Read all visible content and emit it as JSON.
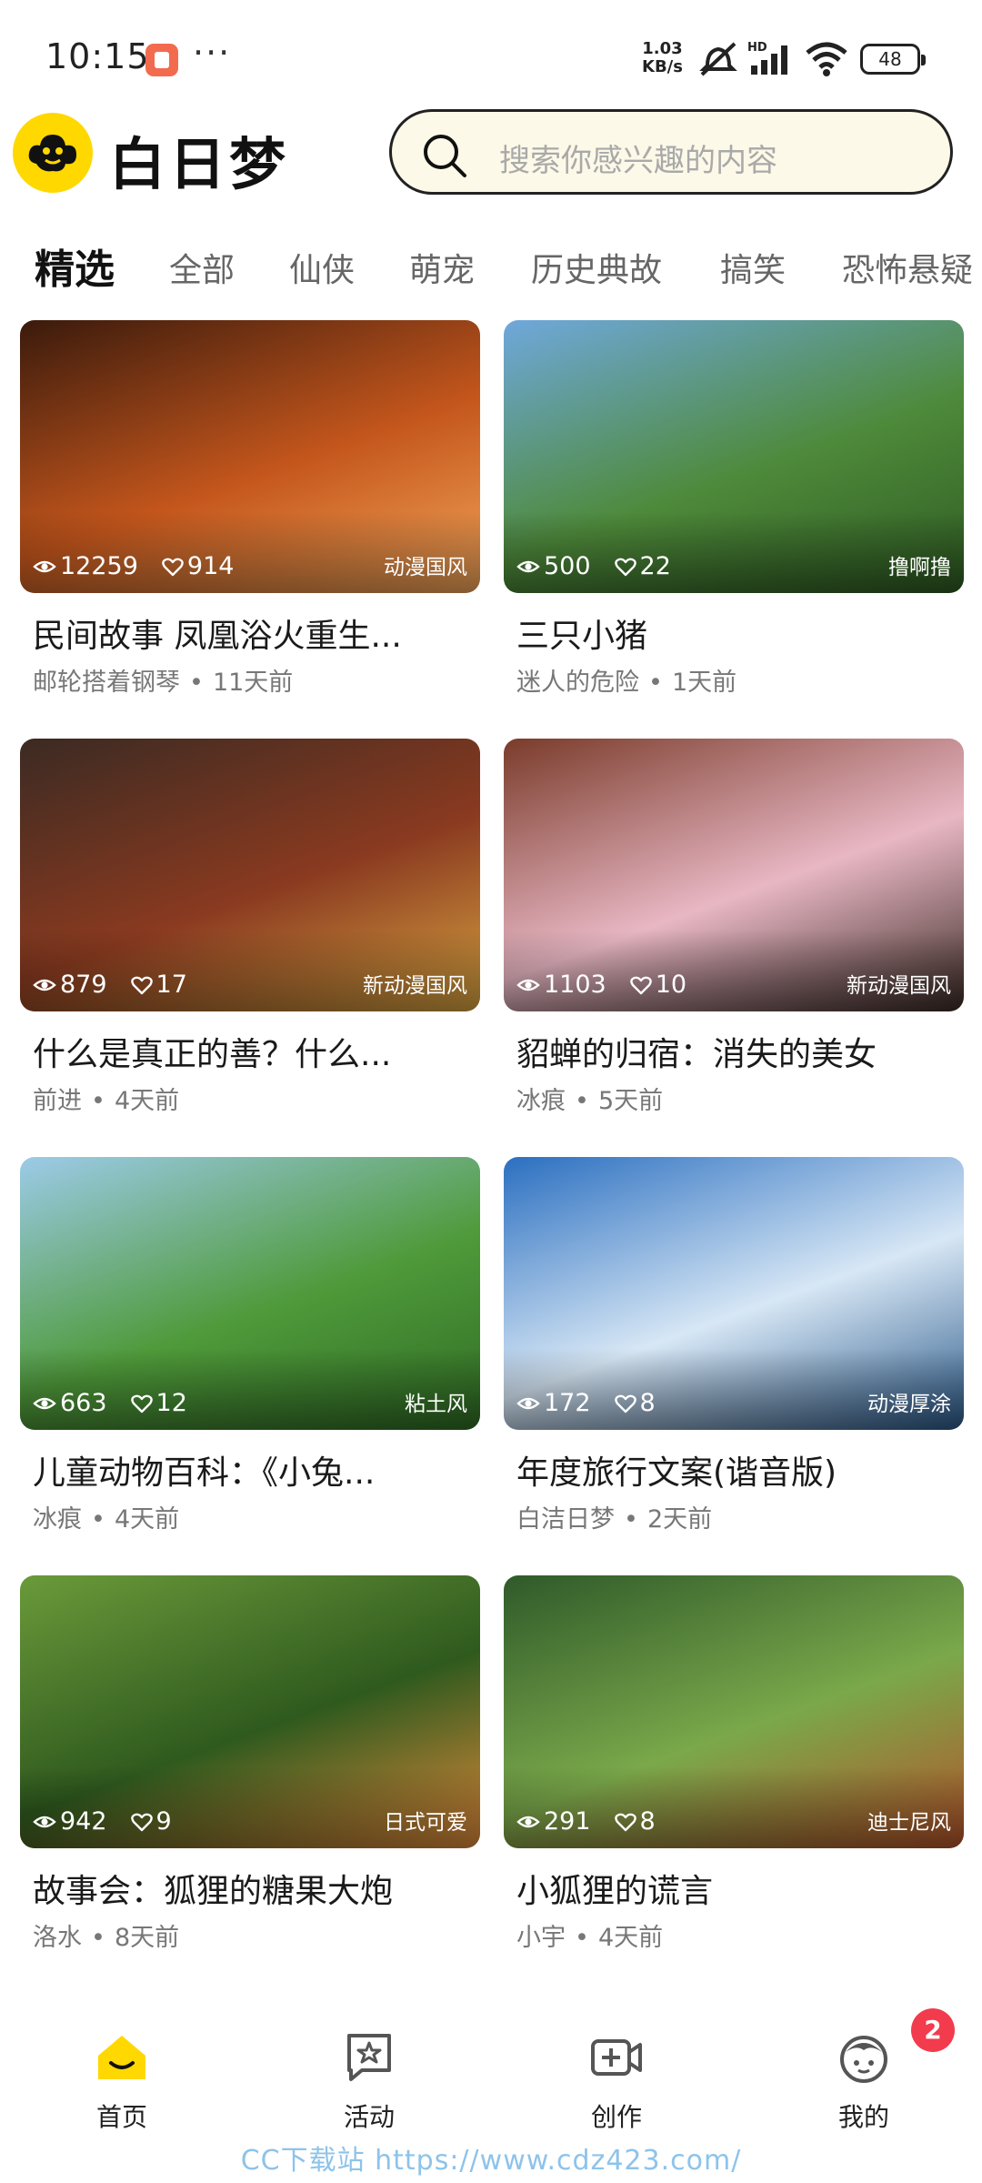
{
  "status_bar": {
    "time": "10:15",
    "net_speed_value": "1.03",
    "net_speed_unit": "KB/s",
    "signal_label": "HD",
    "battery": "48"
  },
  "header": {
    "app_name": "白日梦",
    "search_placeholder": "搜索你感兴趣的内容"
  },
  "tabs": [
    "精选",
    "全部",
    "仙侠",
    "萌宠",
    "历史典故",
    "搞笑",
    "恐怖悬疑"
  ],
  "active_tab": 0,
  "cards": [
    {
      "views": "12259",
      "likes": "914",
      "tag": "动漫国风",
      "title": "民间故事 凤凰浴火重生...",
      "author": "邮轮搭着钢琴",
      "time": "11天前",
      "colors": [
        "#3a1a0c",
        "#c4561c",
        "#f3a65a"
      ]
    },
    {
      "views": "500",
      "likes": "22",
      "tag": "撸啊撸",
      "title": "三只小猪",
      "author": "迷人的危险",
      "time": "1天前",
      "colors": [
        "#6fa8dc",
        "#4e8a3a",
        "#2e5a22"
      ]
    },
    {
      "views": "879",
      "likes": "17",
      "tag": "新动漫国风",
      "title": "什么是真正的善？什么...",
      "author": "前进",
      "time": "4天前",
      "colors": [
        "#3b2a22",
        "#8a3a20",
        "#d9a441"
      ]
    },
    {
      "views": "1103",
      "likes": "10",
      "tag": "新动漫国风",
      "title": "貂蝉的归宿：消失的美女",
      "author": "冰痕",
      "time": "5天前",
      "colors": [
        "#7a3b2a",
        "#e8b7c4",
        "#3a2a24"
      ]
    },
    {
      "views": "663",
      "likes": "12",
      "tag": "粘土风",
      "title": "儿童动物百科：《小兔...",
      "author": "冰痕",
      "time": "4天前",
      "colors": [
        "#9ccbe8",
        "#4f9a3a",
        "#2f6b24"
      ]
    },
    {
      "views": "172",
      "likes": "8",
      "tag": "动漫厚涂",
      "title": "年度旅行文案(谐音版)",
      "author": "白洁日梦",
      "time": "2天前",
      "colors": [
        "#2b6fc0",
        "#d7e7f5",
        "#2c5a8a"
      ]
    },
    {
      "views": "942",
      "likes": "9",
      "tag": "日式可爱",
      "title": "故事会：狐狸的糖果大炮",
      "author": "洛水",
      "time": "8天前",
      "colors": [
        "#6a9a3a",
        "#2f5a1e",
        "#e08a3a"
      ]
    },
    {
      "views": "291",
      "likes": "8",
      "tag": "迪士尼风",
      "title": "小狐狸的谎言",
      "author": "小宇",
      "time": "4天前",
      "colors": [
        "#2f5a2a",
        "#7aa84a",
        "#b5532a"
      ]
    }
  ],
  "bottom_nav": [
    {
      "label": "首页",
      "icon": "home-icon"
    },
    {
      "label": "活动",
      "icon": "activity-icon"
    },
    {
      "label": "创作",
      "icon": "create-video-icon"
    },
    {
      "label": "我的",
      "icon": "profile-icon"
    }
  ],
  "badge_count": "2",
  "watermark": "CC下载站 https://www.cdz423.com/",
  "colors": {
    "accent": "#ffd800",
    "badge": "#f23b4c"
  }
}
